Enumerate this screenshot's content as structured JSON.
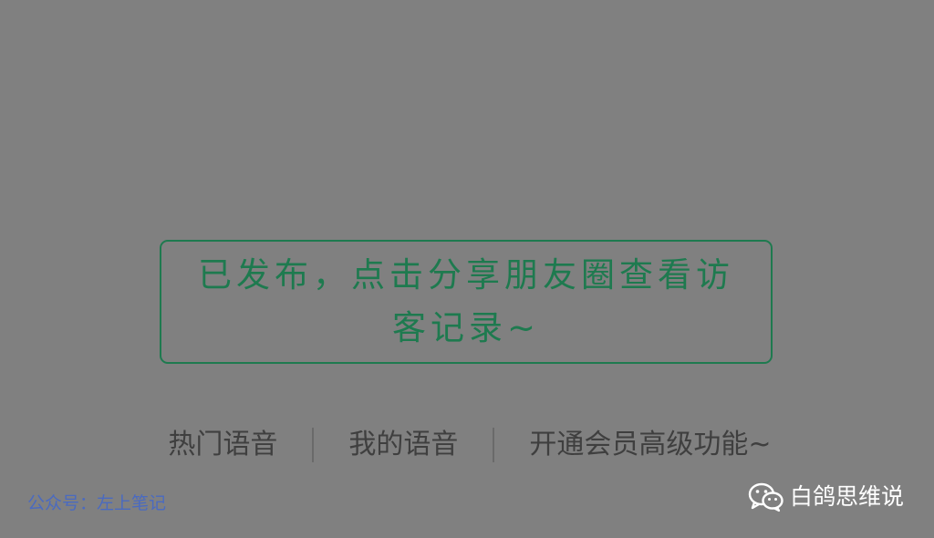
{
  "notice": {
    "line1": "已发布，点击分享朋友圈查看访",
    "line2": "客记录~"
  },
  "links": [
    {
      "label": "热门语音"
    },
    {
      "label": "我的语音"
    },
    {
      "label": "开通会员高级功能~"
    }
  ],
  "watermarks": {
    "left_text": "公众号：左上笔记",
    "right_text": "白鸽思维说",
    "right_icon": "wechat-icon"
  },
  "colors": {
    "background": "#808080",
    "accent": "#1e7a4f",
    "link_text": "#3f3f3f",
    "left_watermark": "#4a6ac0",
    "right_watermark": "#ffffff"
  }
}
